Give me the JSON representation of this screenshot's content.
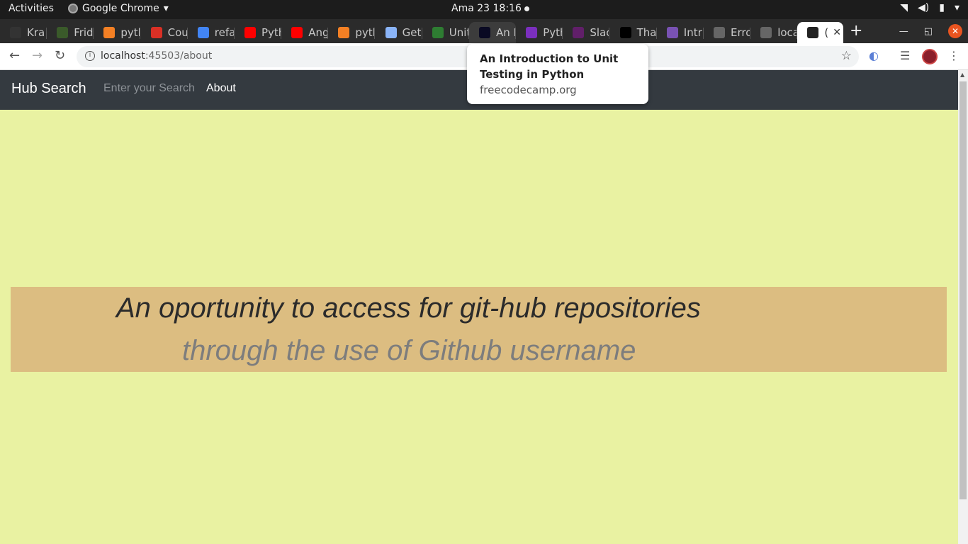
{
  "system": {
    "activities": "Activities",
    "app_name": "Google Chrome",
    "clock": "Ama 23  18:16"
  },
  "tabs": [
    {
      "label": "Kra",
      "icon": "github-icon",
      "color": "#333333"
    },
    {
      "label": "Frid",
      "icon": "palm-icon",
      "color": "#3a5a2a"
    },
    {
      "label": "pyth",
      "icon": "stackoverflow-icon",
      "color": "#f48024"
    },
    {
      "label": "Cou",
      "icon": "gmail-icon",
      "color": "#d93025"
    },
    {
      "label": "refa",
      "icon": "google-icon",
      "color": "#4285f4"
    },
    {
      "label": "Pyth",
      "icon": "youtube-icon",
      "color": "#ff0000"
    },
    {
      "label": "Ang",
      "icon": "youtube-icon",
      "color": "#ff0000"
    },
    {
      "label": "pyth",
      "icon": "stackoverflow-icon",
      "color": "#f48024"
    },
    {
      "label": "Get",
      "icon": "puzzle-icon",
      "color": "#8ab4f8"
    },
    {
      "label": "Unit",
      "icon": "infinity-icon",
      "color": "#2e7d32"
    },
    {
      "label": "An I",
      "icon": "freecodecamp-icon",
      "color": "#0a0a23"
    },
    {
      "label": "Pyth",
      "icon": "pycharm-icon",
      "color": "#7b2fbe"
    },
    {
      "label": "Slac",
      "icon": "slack-icon",
      "color": "#611f69"
    },
    {
      "label": "Tha",
      "icon": "jetbrains-icon",
      "color": "#000000"
    },
    {
      "label": "Intr",
      "icon": "bootstrap-icon",
      "color": "#7952b3"
    },
    {
      "label": "Erro",
      "icon": "globe-icon",
      "color": "#666666"
    },
    {
      "label": "loca",
      "icon": "globe-icon",
      "color": "#666666"
    },
    {
      "label": "(",
      "icon": "angular-icon",
      "color": "#222222"
    }
  ],
  "toolbar": {
    "url_host": "localhost",
    "url_path": ":45503/about"
  },
  "tooltip": {
    "title": "An Introduction to Unit Testing in Python",
    "domain": "freecodecamp.org"
  },
  "page": {
    "brand": "Hub Search",
    "search_placeholder": "Enter your Search",
    "nav_about": "About",
    "hero_line1": "An oportunity to access for git-hub repositories",
    "hero_line2": "through the use of Github username"
  },
  "colors": {
    "page_bg": "#e9f2a2",
    "navbar_bg": "#343a40",
    "hero_bg": "#dcbd81"
  }
}
